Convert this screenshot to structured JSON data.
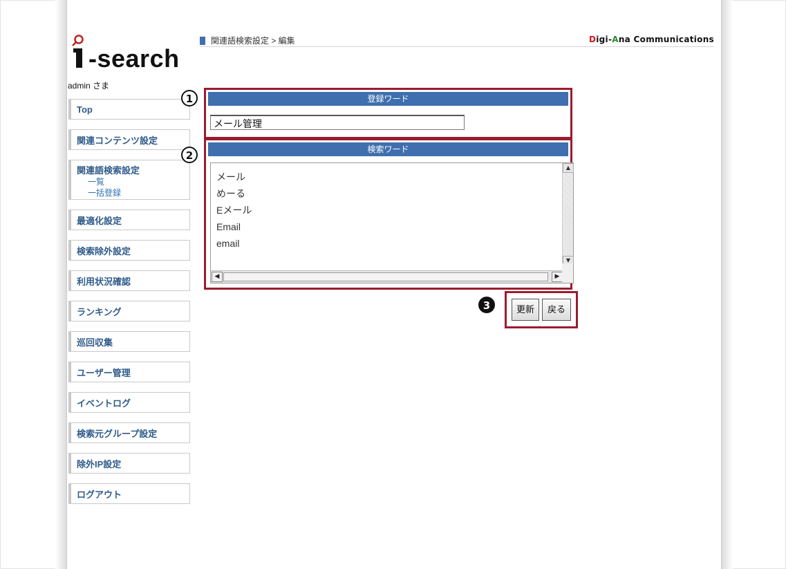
{
  "app": {
    "logo_text": "-search",
    "user_label": "admin さま",
    "brand": {
      "part1": "D",
      "part2": "igi-",
      "part3": "A",
      "part4": "na Communications"
    }
  },
  "breadcrumb": "関連語検索設定 > 編集",
  "sidebar": {
    "items": [
      {
        "label": "Top"
      },
      {
        "label": "関連コンテンツ設定"
      },
      {
        "label": "関連語検索設定",
        "subs": [
          "一覧",
          "一括登録"
        ]
      },
      {
        "label": "最適化設定"
      },
      {
        "label": "検索除外設定"
      },
      {
        "label": "利用状況確認"
      },
      {
        "label": "ランキング"
      },
      {
        "label": "巡回収集"
      },
      {
        "label": "ユーザー管理"
      },
      {
        "label": "イベントログ"
      },
      {
        "label": "検索元グループ設定"
      },
      {
        "label": "除外IP設定"
      },
      {
        "label": "ログアウト"
      }
    ]
  },
  "form": {
    "registered_word_header": "登録ワード",
    "registered_word_value": "メール管理",
    "search_words_header": "検索ワード",
    "search_words": [
      "メール",
      "めーる",
      "Eメール",
      "Email",
      "email"
    ],
    "update_label": "更新",
    "back_label": "戻る"
  },
  "annotations": {
    "n1": "1",
    "n2": "2",
    "n3": "3"
  },
  "colors": {
    "accent": "#3f6fae",
    "highlight": "#9b1c2e",
    "nav_text": "#2f5b8a"
  }
}
